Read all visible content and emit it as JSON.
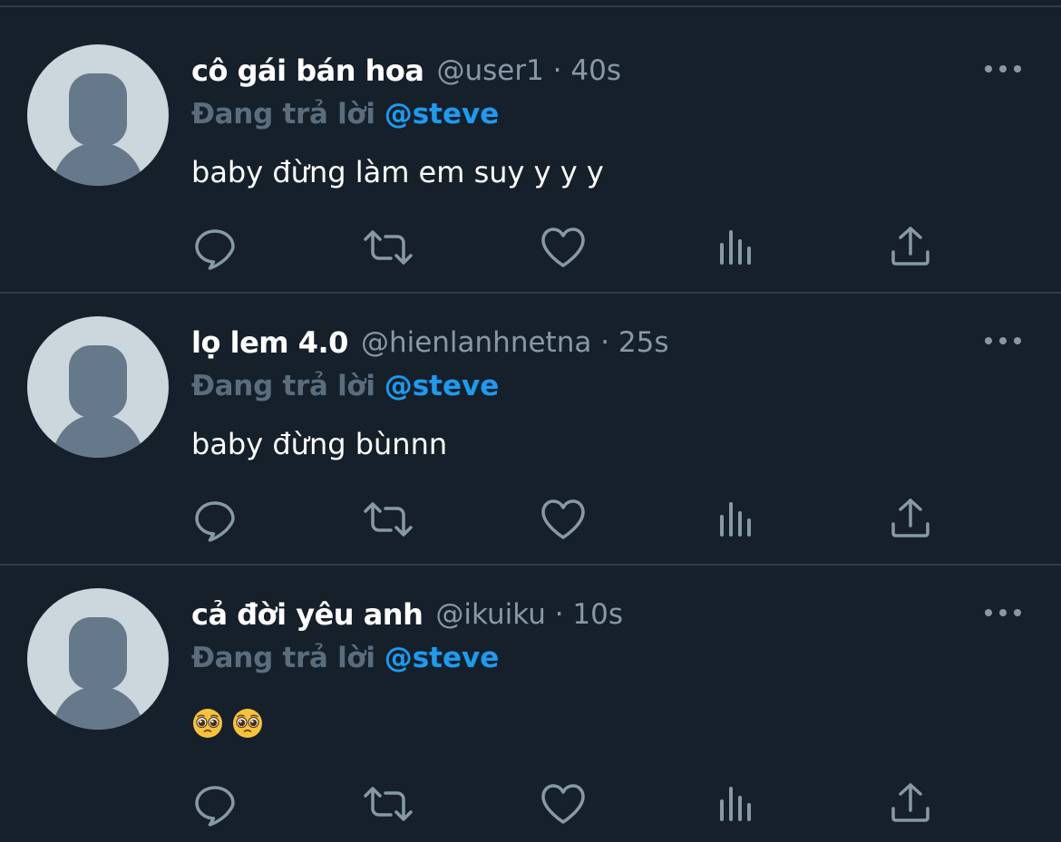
{
  "tweets": [
    {
      "display_name": "cô gái bán hoa",
      "handle_time": "@user1 · 40s",
      "reply_prefix": "Đang trả lời",
      "mention": "@steve",
      "text": "baby đừng làm em suy y y y"
    },
    {
      "display_name": "lọ lem 4.0",
      "handle_time": "@hienlanhnetna · 25s",
      "reply_prefix": "Đang trả lời",
      "mention": "@steve",
      "text": "baby đừng bùnnn"
    },
    {
      "display_name": "cả đời yêu anh",
      "handle_time": "@ikuiku · 10s",
      "reply_prefix": "Đang trả lời",
      "mention": "@steve",
      "text": ""
    }
  ],
  "icons": {
    "reply": "reply-icon",
    "retweet": "retweet-icon",
    "like": "like-icon",
    "analytics": "analytics-icon",
    "share": "share-icon",
    "more": "more-icon",
    "emoji": "pleading-face-emoji"
  },
  "colors": {
    "background": "#15202b",
    "text_primary": "#ffffff",
    "text_secondary": "#8899a6",
    "mention": "#1d9bf0",
    "divider": "#2f3d4b"
  }
}
